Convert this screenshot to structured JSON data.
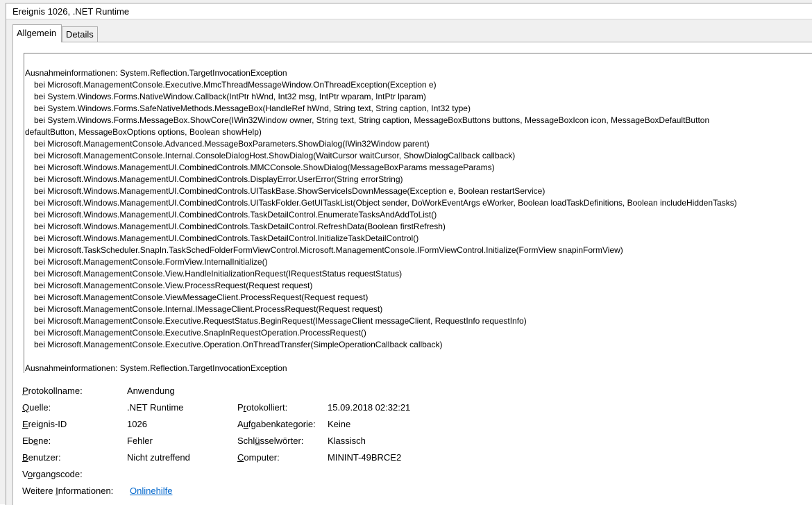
{
  "window": {
    "title": "Ereignis 1026, .NET Runtime"
  },
  "tabs": [
    {
      "label": "Allgemein",
      "active": true
    },
    {
      "label": "Details",
      "active": false
    }
  ],
  "description": {
    "header": "Ausnahmeinformationen: System.Reflection.TargetInvocationException",
    "lines": [
      "bei Microsoft.ManagementConsole.Executive.MmcThreadMessageWindow.OnThreadException(Exception e)",
      "bei System.Windows.Forms.NativeWindow.Callback(IntPtr hWnd, Int32 msg, IntPtr wparam, IntPtr lparam)",
      "bei System.Windows.Forms.SafeNativeMethods.MessageBox(HandleRef hWnd, String text, String caption, Int32 type)",
      "bei System.Windows.Forms.MessageBox.ShowCore(IWin32Window owner, String text, String caption, MessageBoxButtons buttons, MessageBoxIcon icon, MessageBoxDefaultButton",
      "defaultButton, MessageBoxOptions options, Boolean showHelp)",
      "bei Microsoft.ManagementConsole.Advanced.MessageBoxParameters.ShowDialog(IWin32Window parent)",
      "bei Microsoft.ManagementConsole.Internal.ConsoleDialogHost.ShowDialog(WaitCursor waitCursor, ShowDialogCallback callback)",
      "bei Microsoft.Windows.ManagementUI.CombinedControls.MMCConsole.ShowDialog(MessageBoxParams messageParams)",
      "bei Microsoft.Windows.ManagementUI.CombinedControls.DisplayError.UserError(String errorString)",
      "bei Microsoft.Windows.ManagementUI.CombinedControls.UITaskBase.ShowServiceIsDownMessage(Exception e, Boolean restartService)",
      "bei Microsoft.Windows.ManagementUI.CombinedControls.UITaskFolder.GetUITaskList(Object sender, DoWorkEventArgs eWorker, Boolean loadTaskDefinitions, Boolean includeHiddenTasks)",
      "bei Microsoft.Windows.ManagementUI.CombinedControls.TaskDetailControl.EnumerateTasksAndAddToList()",
      "bei Microsoft.Windows.ManagementUI.CombinedControls.TaskDetailControl.RefreshData(Boolean firstRefresh)",
      "bei Microsoft.Windows.ManagementUI.CombinedControls.TaskDetailControl.InitializeTaskDetailControl()",
      "bei Microsoft.TaskScheduler.SnapIn.TaskSchedFolderFormViewControl.Microsoft.ManagementConsole.IFormViewControl.Initialize(FormView snapinFormView)",
      "bei Microsoft.ManagementConsole.FormView.InternalInitialize()",
      "bei Microsoft.ManagementConsole.View.HandleInitializationRequest(IRequestStatus requestStatus)",
      "bei Microsoft.ManagementConsole.View.ProcessRequest(Request request)",
      "bei Microsoft.ManagementConsole.ViewMessageClient.ProcessRequest(Request request)",
      "bei Microsoft.ManagementConsole.Internal.IMessageClient.ProcessRequest(Request request)",
      "bei Microsoft.ManagementConsole.Executive.RequestStatus.BeginRequest(IMessageClient messageClient, RequestInfo requestInfo)",
      "bei Microsoft.ManagementConsole.Executive.SnapInRequestOperation.ProcessRequest()",
      "bei Microsoft.ManagementConsole.Executive.Operation.OnThreadTransfer(SimpleOperationCallback callback)"
    ],
    "footer": "Ausnahmeinformationen: System.Reflection.TargetInvocationException"
  },
  "properties": {
    "log_name": {
      "label_u": "P",
      "label_rest": "rotokollname:",
      "value": "Anwendung"
    },
    "source": {
      "label_u": "Q",
      "label_rest": "uelle:",
      "value": ".NET Runtime"
    },
    "logged": {
      "label_pre": "P",
      "label_u": "r",
      "label_rest": "otokolliert:",
      "value": "15.09.2018 02:32:21"
    },
    "event_id": {
      "label_u": "E",
      "label_rest": "reignis-ID",
      "value": "1026"
    },
    "task_category": {
      "label_pre": "A",
      "label_u": "u",
      "label_rest": "fgabenkategorie:",
      "value": "Keine"
    },
    "level": {
      "label_pre": "Eb",
      "label_u": "e",
      "label_rest": "ne:",
      "value": "Fehler"
    },
    "keywords": {
      "label_pre": "Schl",
      "label_u": "ü",
      "label_rest": "sselwörter:",
      "value": "Klassisch"
    },
    "user": {
      "label_u": "B",
      "label_rest": "enutzer:",
      "value": "Nicht zutreffend"
    },
    "computer": {
      "label_u": "C",
      "label_rest": "omputer:",
      "value": "MININT-49BRCE2"
    },
    "opcode": {
      "label_pre": "V",
      "label_u": "o",
      "label_rest": "rgangscode:",
      "value": ""
    },
    "more_info": {
      "label_pre": "Weitere ",
      "label_u": "I",
      "label_rest": "nformationen:",
      "link": "Onlinehilfe"
    }
  }
}
